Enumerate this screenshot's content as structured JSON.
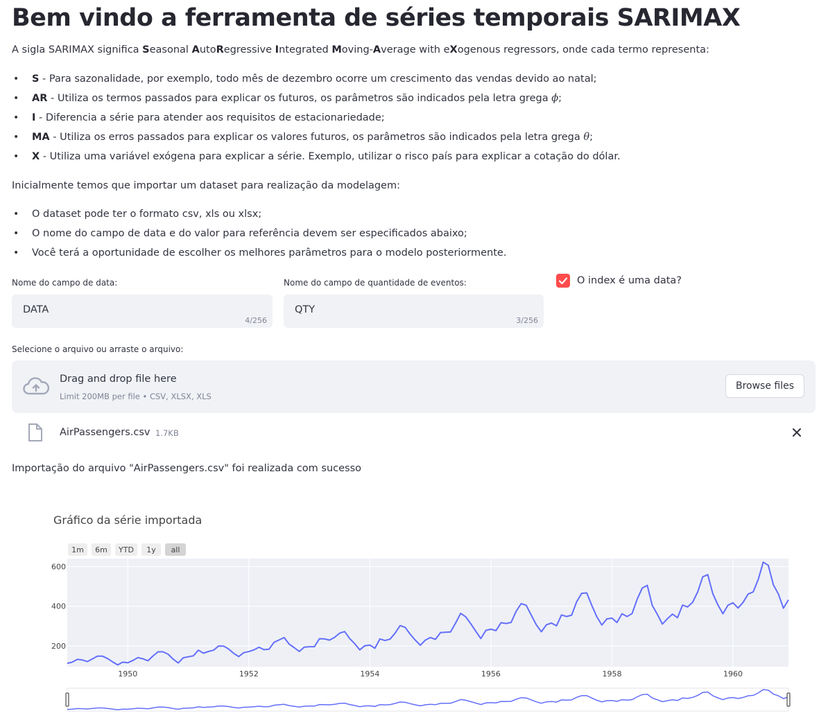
{
  "page": {
    "title": "Bem vindo a ferramenta de séries temporais SARIMAX",
    "intro": {
      "before": "A sigla SARIMAX significa ",
      "words": [
        {
          "b": "S",
          "r": "easonal "
        },
        {
          "b": "A",
          "r": "uto"
        },
        {
          "b": "R",
          "r": "egressive "
        },
        {
          "b": "I",
          "r": "ntegrated "
        },
        {
          "b": "M",
          "r": "oving-"
        },
        {
          "b": "A",
          "r": "verage with e"
        },
        {
          "b": "X",
          "r": "ogenous regressors, onde cada termo representa:"
        }
      ]
    },
    "terms": [
      {
        "key": "S",
        "text": " - Para sazonalidade, por exemplo, todo mês de dezembro ocorre um crescimento das vendas devido ao natal;",
        "greek": ""
      },
      {
        "key": "AR",
        "text": " - Utiliza os termos passados para explicar os futuros, os parâmetros são indicados pela letra grega ",
        "greek": "ϕ",
        "tail": ";"
      },
      {
        "key": "I",
        "text": " - Diferencia a série para atender aos requisitos de estacionariedade;",
        "greek": ""
      },
      {
        "key": "MA",
        "text": " - Utiliza os erros passados para explicar os valores futuros, os parâmetros são indicados pela letra grega ",
        "greek": "θ",
        "tail": ";"
      },
      {
        "key": "X",
        "text": " - Utiliza uma variável exógena para explicar a série. Exemplo, utilizar o risco país para explicar a cotação do dólar.",
        "greek": ""
      }
    ],
    "import_intro": "Inicialmente temos que importar um dataset para realização da modelagem:",
    "import_items": [
      "O dataset pode ter o formato csv, xls ou xlsx;",
      "O nome do campo de data e do valor para referência devem ser especificados abaixo;",
      "Você terá a oportunidade de escolher os melhores parâmetros para o modelo posteriormente."
    ]
  },
  "form": {
    "date_label": "Nome do campo de data:",
    "date_value": "DATA",
    "date_counter": "4/256",
    "qty_label": "Nome do campo de quantidade de eventos:",
    "qty_value": "QTY",
    "qty_counter": "3/256",
    "index_checkbox_label": "O index é uma data?",
    "index_checked": true
  },
  "uploader": {
    "label": "Selecione o arquivo ou arraste o arquivo:",
    "drop_text": "Drag and drop file here",
    "limit_text": "Limit 200MB per file • CSV, XLSX, XLS",
    "browse_label": "Browse files",
    "file_name": "AirPassengers.csv",
    "file_size": "1.7KB"
  },
  "success_message": "Importação do arquivo \"AirPassengers.csv\" foi realizada com sucesso",
  "colors": {
    "accent": "#ff4b4b",
    "line": "#636efa",
    "plot_bg": "#eef0f6"
  },
  "chart_data": {
    "type": "line",
    "title": "Gráfico da série importada",
    "range_buttons": [
      "1m",
      "6m",
      "YTD",
      "1y",
      "all"
    ],
    "active_range": "all",
    "x_start": "1949-01",
    "x_end": "1960-12",
    "x_frequency": "monthly",
    "x_ticks": [
      "1950",
      "1952",
      "1954",
      "1956",
      "1958",
      "1960"
    ],
    "y_ticks": [
      200,
      400,
      600
    ],
    "ylim": [
      95,
      640
    ],
    "grid": true,
    "range_slider": true,
    "series": [
      {
        "values": [
          112,
          118,
          132,
          129,
          121,
          135,
          148,
          148,
          136,
          119,
          104,
          118,
          115,
          126,
          141,
          135,
          125,
          149,
          170,
          170,
          158,
          133,
          114,
          140,
          145,
          150,
          178,
          163,
          172,
          178,
          199,
          199,
          184,
          162,
          146,
          166,
          171,
          180,
          193,
          181,
          183,
          218,
          230,
          242,
          209,
          191,
          172,
          194,
          196,
          196,
          236,
          235,
          229,
          243,
          264,
          272,
          237,
          211,
          180,
          201,
          204,
          188,
          235,
          227,
          234,
          264,
          302,
          293,
          259,
          229,
          203,
          229,
          242,
          233,
          267,
          269,
          270,
          315,
          364,
          347,
          312,
          274,
          237,
          278,
          284,
          277,
          317,
          313,
          318,
          374,
          413,
          405,
          355,
          306,
          271,
          306,
          315,
          301,
          356,
          348,
          355,
          422,
          465,
          467,
          404,
          347,
          305,
          336,
          340,
          318,
          362,
          348,
          363,
          435,
          491,
          505,
          404,
          359,
          310,
          337,
          360,
          342,
          406,
          396,
          420,
          472,
          548,
          559,
          463,
          407,
          362,
          405,
          417,
          391,
          419,
          461,
          472,
          535,
          622,
          606,
          508,
          461,
          390,
          432
        ]
      }
    ]
  }
}
